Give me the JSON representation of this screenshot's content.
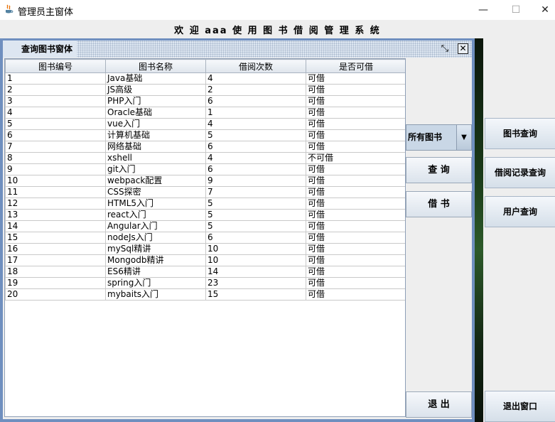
{
  "window": {
    "title": "管理员主窗体",
    "controls": {
      "minimize": "—",
      "maximize": "☐",
      "close": "✕"
    }
  },
  "welcome": "欢 迎 aaa 使 用 图 书 借 阅 管 理 系 统",
  "internal_frame": {
    "title": "查询图书窗体",
    "icons": {
      "restore": "⤡",
      "close": "✕"
    },
    "table": {
      "columns": [
        "图书编号",
        "图书名称",
        "借阅次数",
        "是否可借"
      ],
      "rows": [
        [
          "1",
          "Java基础",
          "4",
          "可借"
        ],
        [
          "2",
          "JS高级",
          "2",
          "可借"
        ],
        [
          "3",
          "PHP入门",
          "6",
          "可借"
        ],
        [
          "4",
          "Oracle基础",
          "1",
          "可借"
        ],
        [
          "5",
          "vue入门",
          "4",
          "可借"
        ],
        [
          "6",
          "计算机基础",
          "5",
          "可借"
        ],
        [
          "7",
          "网络基础",
          "6",
          "可借"
        ],
        [
          "8",
          "xshell",
          "4",
          "不可借"
        ],
        [
          "9",
          "git入门",
          "6",
          "可借"
        ],
        [
          "10",
          "webpack配置",
          "9",
          "可借"
        ],
        [
          "11",
          "CSS探密",
          "7",
          "可借"
        ],
        [
          "12",
          "HTML5入门",
          "5",
          "可借"
        ],
        [
          "13",
          "react入门",
          "5",
          "可借"
        ],
        [
          "14",
          "Angular入门",
          "5",
          "可借"
        ],
        [
          "15",
          "nodeJs入门",
          "6",
          "可借"
        ],
        [
          "16",
          "mySql精讲",
          "10",
          "可借"
        ],
        [
          "17",
          "Mongodb精讲",
          "10",
          "可借"
        ],
        [
          "18",
          "ES6精讲",
          "14",
          "可借"
        ],
        [
          "19",
          "spring入门",
          "23",
          "可借"
        ],
        [
          "20",
          "mybaits入门",
          "15",
          "可借"
        ]
      ]
    },
    "filter_select": {
      "value": "所有图书"
    },
    "buttons": {
      "query": "查 询",
      "borrow": "借 书",
      "exit": "退 出"
    }
  },
  "side_buttons": {
    "book_query": "图书查询",
    "borrow_records": "借阅记录查询",
    "user_query": "用户查询",
    "exit_window": "退出窗口"
  }
}
